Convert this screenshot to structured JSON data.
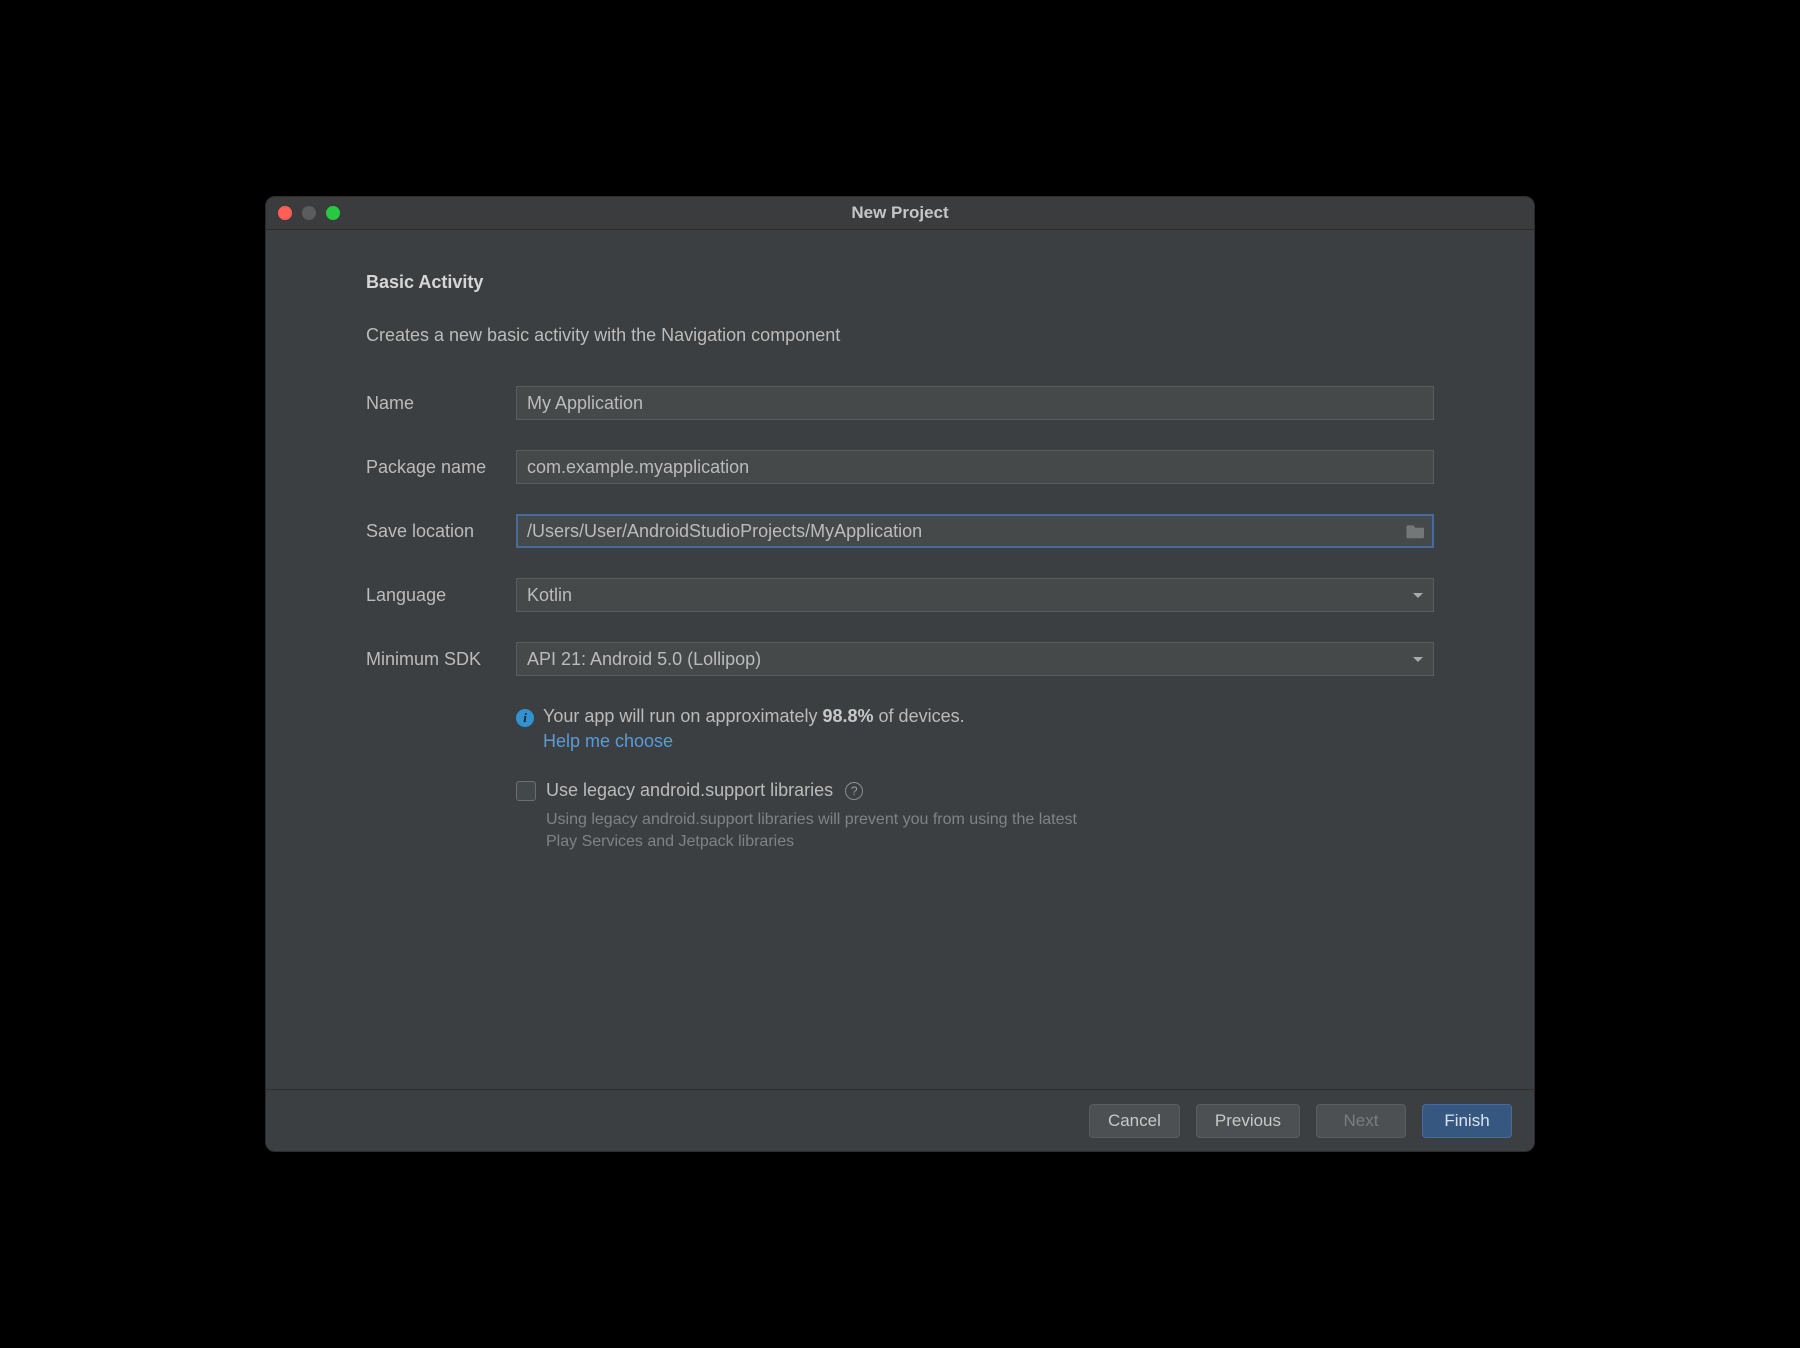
{
  "window": {
    "title": "New Project"
  },
  "heading": "Basic Activity",
  "subheading": "Creates a new basic activity with the Navigation component",
  "fields": {
    "name": {
      "label": "Name",
      "value": "My Application"
    },
    "package": {
      "label": "Package name",
      "value": "com.example.myapplication"
    },
    "location": {
      "label": "Save location",
      "value": "/Users/User/AndroidStudioProjects/MyApplication"
    },
    "language": {
      "label": "Language",
      "value": "Kotlin"
    },
    "minsdk": {
      "label": "Minimum SDK",
      "value": "API 21: Android 5.0 (Lollipop)"
    }
  },
  "info": {
    "prefix": "Your app will run on approximately ",
    "percent": "98.8%",
    "suffix": " of devices.",
    "help_link": "Help me choose"
  },
  "legacy": {
    "label": "Use legacy android.support libraries",
    "hint": "Using legacy android.support libraries will prevent you from using the latest Play Services and Jetpack libraries"
  },
  "buttons": {
    "cancel": "Cancel",
    "previous": "Previous",
    "next": "Next",
    "finish": "Finish"
  }
}
